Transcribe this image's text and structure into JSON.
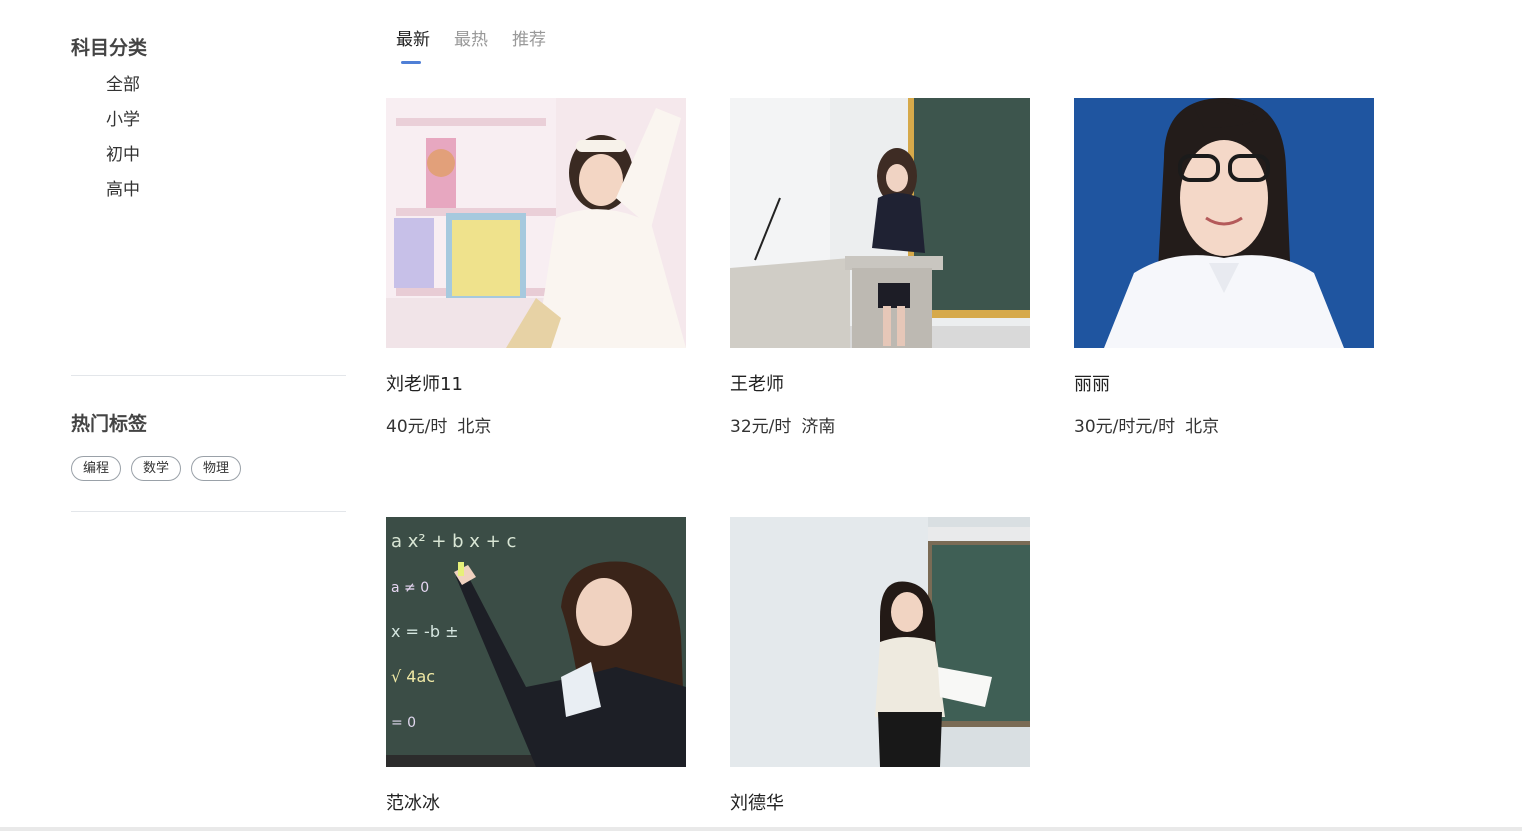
{
  "sidebar": {
    "category_title": "科目分类",
    "categories": [
      "全部",
      "小学",
      "初中",
      "高中"
    ],
    "tags_title": "热门标签",
    "tags": [
      "编程",
      "数学",
      "物理"
    ]
  },
  "tabs": [
    {
      "label": "最新",
      "active": true
    },
    {
      "label": "最热",
      "active": false
    },
    {
      "label": "推荐",
      "active": false
    }
  ],
  "teachers": [
    {
      "name": "刘老师11",
      "price": "40元/时",
      "city": "北京"
    },
    {
      "name": "王老师",
      "price": "32元/时",
      "city": "济南"
    },
    {
      "name": "丽丽",
      "price": "30元/时元/时",
      "city": "北京"
    },
    {
      "name": "范冰冰"
    },
    {
      "name": "刘德华"
    }
  ],
  "colors": {
    "accent": "#4f7fd6",
    "id_photo_bg": "#1f55a0",
    "chalkboard": "#3b4d46"
  }
}
